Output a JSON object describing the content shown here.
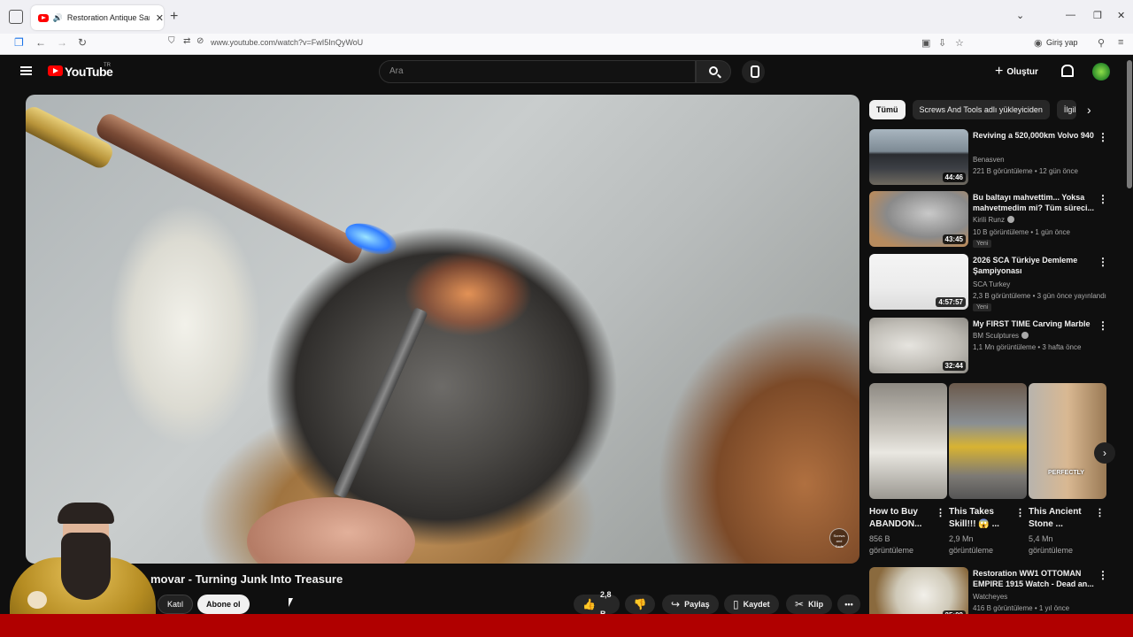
{
  "browser": {
    "tab_title": "Restoration Antique Samov",
    "url": "www.youtube.com/watch?v=FwI5InQyWoU",
    "signin": "Giriş yap"
  },
  "header": {
    "logo_text": "YouTube",
    "logo_region": "TR",
    "search_placeholder": "Ara",
    "create_label": "Oluştur"
  },
  "video": {
    "title": "Restoration Antique Samovar - Turning Junk Into Treasure",
    "title_visible": "movar - Turning Junk Into Treasure",
    "watermark": "Screws and Tools"
  },
  "actions": {
    "join": "Katıl",
    "subscribe": "Abone ol",
    "likes": "2,8 B",
    "share": "Paylaş",
    "save": "Kaydet",
    "clip": "Klip"
  },
  "chips": [
    "Tümü",
    "Screws And Tools adlı yükleyiciden",
    "İlgili"
  ],
  "recommendations": [
    {
      "title": "Reviving a 520,000km Volvo 940",
      "channel": "Benasven",
      "meta": "221 B görüntüleme • 12 gün önce",
      "duration": "44:46",
      "new": ""
    },
    {
      "title": "Bu baltayı mahvettim... Yoksa mahvetmedim mi? Tüm süreci...",
      "channel": "Kirili Runz",
      "meta": "10 B görüntüleme • 1 gün önce",
      "duration": "43:45",
      "new": "Yeni"
    },
    {
      "title": "2026 SCA Türkiye Demleme Şampiyonası",
      "channel": "SCA Turkey",
      "meta": "2,3 B görüntüleme • 3 gün önce yayınlandı",
      "duration": "4:57:57",
      "new": "Yeni"
    },
    {
      "title": "My FIRST TIME Carving Marble",
      "channel": "BM Sculptures",
      "meta": "1,1 Mn görüntüleme • 3 hafta önce",
      "duration": "32:44",
      "new": ""
    },
    {
      "title": "Restoration WW1 OTTOMAN EMPIRE 1915 Watch - Dead an...",
      "channel": "Watcheyes",
      "meta": "416 B görüntüleme • 1 yıl önce",
      "duration": "25:09",
      "new": ""
    }
  ],
  "shorts": [
    {
      "title": "How to Buy ABANDON...",
      "views": "856 B görüntüleme",
      "overlay": ""
    },
    {
      "title": "This Takes Skill!!! 😱 ...",
      "views": "2,9 Mn görüntüleme",
      "overlay": ""
    },
    {
      "title": "This Ancient Stone ...",
      "views": "5,4 Mn görüntüleme",
      "overlay": "PERFECTLY"
    }
  ],
  "icons": {
    "more": "⋮",
    "next": "›"
  }
}
